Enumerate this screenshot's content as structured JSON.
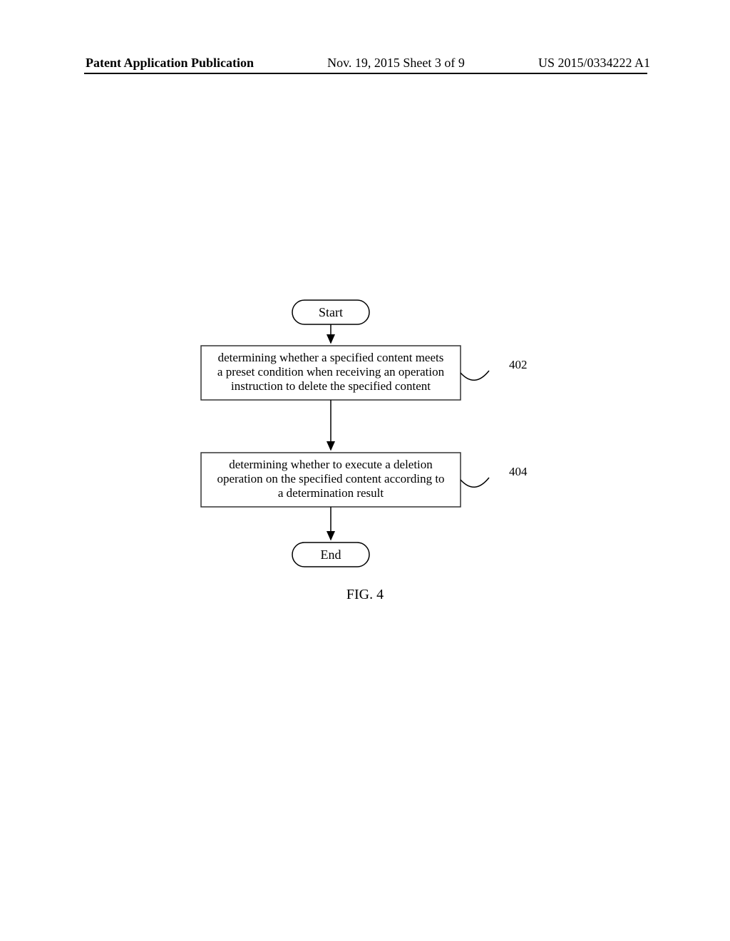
{
  "header": {
    "left": "Patent Application Publication",
    "center": "Nov. 19, 2015  Sheet 3 of 9",
    "right": "US 2015/0334222 A1"
  },
  "flowchart": {
    "start": "Start",
    "step1": {
      "line1": "determining whether a specified content meets",
      "line2": "a preset condition when receiving an operation",
      "line3": "instruction to delete the specified content",
      "ref": "402"
    },
    "step2": {
      "line1": "determining whether to execute a deletion",
      "line2": "operation on the specified content according to",
      "line3": "a determination result",
      "ref": "404"
    },
    "end": "End"
  },
  "figure_caption": "FIG. 4"
}
